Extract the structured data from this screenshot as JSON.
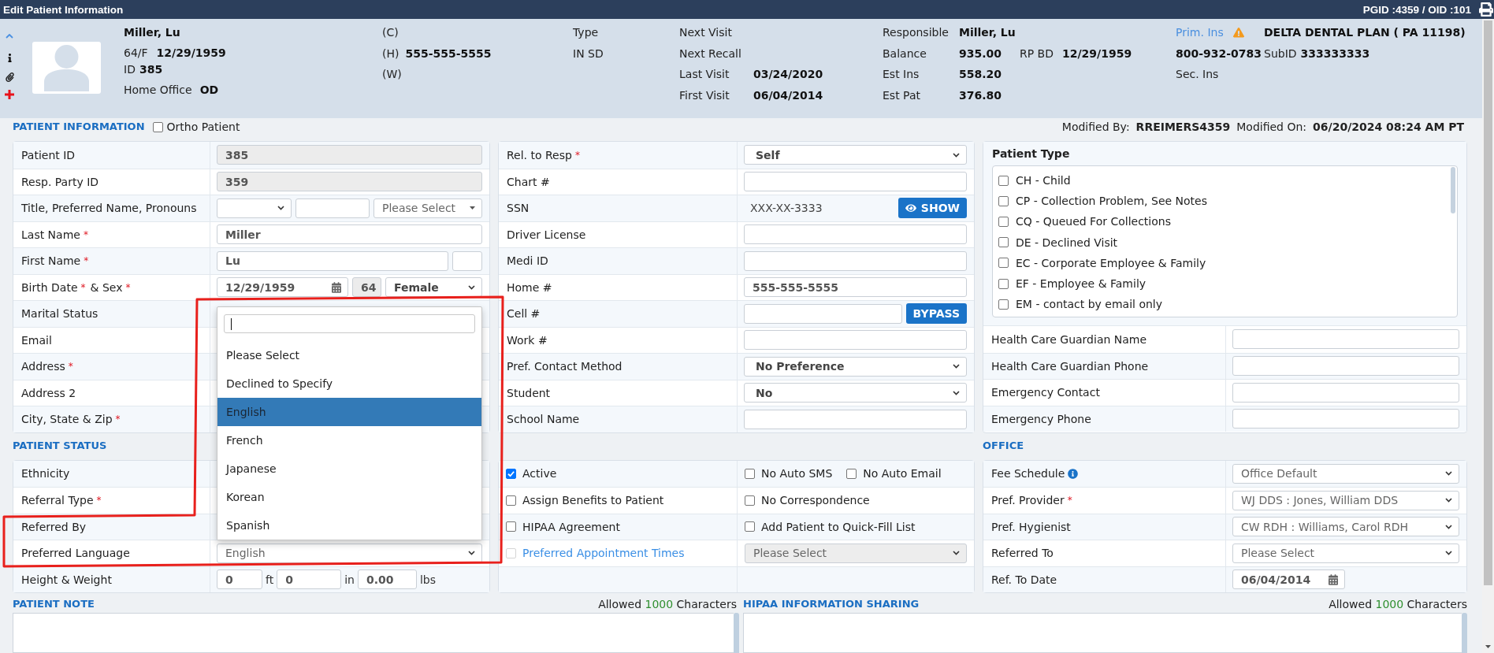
{
  "window": {
    "title": "Edit Patient Information",
    "ids": "PGID :4359 / OID :101"
  },
  "required_mark": "*",
  "header": {
    "name": "Miller, Lu",
    "age_sex": "64/F",
    "birth_date": "12/29/1959",
    "id_label": "ID",
    "id": "385",
    "office_label": "Home Office",
    "office": "OD",
    "phones": [
      {
        "label": "(C)"
      },
      {
        "label": "(H)",
        "value": "555-555-5555"
      },
      {
        "label": "(W)"
      }
    ],
    "type": {
      "label": "Type",
      "value": "IN SD"
    },
    "visits": [
      {
        "label": "Next Visit"
      },
      {
        "label": "Next Recall"
      },
      {
        "label": "Last Visit",
        "value": "03/24/2020"
      },
      {
        "label": "First Visit",
        "value": "06/04/2014"
      }
    ],
    "account": [
      {
        "label": "Responsible",
        "value": "Miller, Lu"
      },
      {
        "label": "Balance",
        "value": "935.00",
        "extra_label": "RP BD",
        "extra_value": "12/29/1959"
      },
      {
        "label": "Est Ins",
        "value": "558.20"
      },
      {
        "label": "Est Pat",
        "value": "376.80"
      }
    ],
    "insurance": {
      "primary_label": "Prim. Ins",
      "primary_warning": true,
      "primary_plan": "DELTA DENTAL PLAN ( PA 11198)",
      "primary_phone": "800-932-0783",
      "subid_label": "SubID",
      "subid": "333333333",
      "secondary_label": "Sec. Ins"
    }
  },
  "patient_information": {
    "title": "PATIENT INFORMATION",
    "ortho": {
      "label": "Ortho Patient",
      "checked": false
    },
    "modified": {
      "by_label": "Modified By:",
      "by": "RREIMERS4359",
      "on_label": "Modified On:",
      "on": "06/20/2024 08:24 AM PT"
    },
    "left_rows": [
      {
        "label": "Patient ID",
        "kind": "readonly",
        "value": "385"
      },
      {
        "label": "Resp. Party ID",
        "kind": "readonly",
        "value": "359"
      },
      {
        "label": "Title, Preferred Name, Pronouns",
        "kind": "title_name_pronouns",
        "pronouns_placeholder": "Please Select"
      },
      {
        "label": "Last Name",
        "required": true,
        "kind": "text",
        "value": "Miller"
      },
      {
        "label": "First Name",
        "required": true,
        "kind": "name_suffix",
        "value": "Lu"
      },
      {
        "label": "Birth Date",
        "required": true,
        "extra_label": "& Sex",
        "extra_required": true,
        "kind": "birth_sex",
        "birth_date": "12/29/1959",
        "age": "64",
        "sex": "Female"
      },
      {
        "label": "Marital Status",
        "kind": "covered"
      },
      {
        "label": "Email",
        "kind": "covered"
      },
      {
        "label": "Address",
        "required": true,
        "kind": "covered"
      },
      {
        "label": "Address 2",
        "kind": "covered"
      },
      {
        "label": "City, State & Zip",
        "required": true,
        "kind": "covered"
      }
    ],
    "middle_rows": [
      {
        "label": "Rel. to Resp",
        "required": true,
        "kind": "select",
        "value": "Self"
      },
      {
        "label": "Chart #",
        "kind": "text"
      },
      {
        "label": "SSN",
        "kind": "masked",
        "value": "XXX-XX-3333",
        "button": "SHOW"
      },
      {
        "label": "Driver License",
        "kind": "text"
      },
      {
        "label": "Medi ID",
        "kind": "text"
      },
      {
        "label": "Home #",
        "kind": "text",
        "value": "555-555-5555"
      },
      {
        "label": "Cell #",
        "kind": "text_button",
        "button": "BYPASS"
      },
      {
        "label": "Work #",
        "kind": "text"
      },
      {
        "label": "Pref. Contact Method",
        "kind": "select",
        "value": "No Preference"
      },
      {
        "label": "Student",
        "kind": "select",
        "value": "No"
      },
      {
        "label": "School Name",
        "kind": "text"
      }
    ],
    "patient_type": {
      "title": "Patient Type",
      "options": [
        {
          "label": "CH - Child",
          "checked": false
        },
        {
          "label": "CP - Collection Problem, See Notes",
          "checked": false
        },
        {
          "label": "CQ - Queued For Collections",
          "checked": false
        },
        {
          "label": "DE - Declined Visit",
          "checked": false
        },
        {
          "label": "EC - Corporate Employee & Family",
          "checked": false
        },
        {
          "label": "EF - Employee & Family",
          "checked": false
        },
        {
          "label": "EM - contact by email only",
          "checked": false
        }
      ]
    },
    "right_rows": [
      {
        "label": "Health Care Guardian Name",
        "kind": "text"
      },
      {
        "label": "Health Care Guardian Phone",
        "kind": "text"
      },
      {
        "label": "Emergency Contact",
        "kind": "text"
      },
      {
        "label": "Emergency Phone",
        "kind": "text"
      }
    ]
  },
  "patient_status": {
    "title": "PATIENT STATUS",
    "rows": [
      {
        "label": "Ethnicity",
        "kind": "covered"
      },
      {
        "label": "Referral Type",
        "required": true,
        "kind": "covered"
      },
      {
        "label": "Referred By",
        "kind": "covered"
      },
      {
        "label": "Preferred Language",
        "kind": "select",
        "value": "English",
        "open": true,
        "options": [
          {
            "label": "Please Select",
            "selected": false
          },
          {
            "label": "Declined to Specify",
            "selected": false
          },
          {
            "label": "English",
            "selected": true
          },
          {
            "label": "French",
            "selected": false
          },
          {
            "label": "Japanese",
            "selected": false
          },
          {
            "label": "Korean",
            "selected": false
          },
          {
            "label": "Spanish",
            "selected": false
          }
        ]
      },
      {
        "label": "Height & Weight",
        "kind": "height_weight",
        "feet": "0",
        "feet_unit": "ft",
        "inches": "0",
        "inches_unit": "in",
        "weight": "0.00",
        "weight_unit": "lbs"
      }
    ],
    "flag_rows": [
      {
        "left": [
          {
            "kind": "checkbox",
            "label": "Active",
            "checked": true,
            "disabled": false
          }
        ],
        "right": [
          {
            "kind": "checkbox",
            "label": "No Auto SMS",
            "checked": false,
            "disabled": false
          },
          {
            "kind": "checkbox",
            "label": "No Auto Email",
            "checked": false,
            "disabled": false
          }
        ]
      },
      {
        "left": [
          {
            "kind": "checkbox",
            "label": "Assign Benefits to Patient",
            "checked": false,
            "disabled": false
          }
        ],
        "right": [
          {
            "kind": "checkbox",
            "label": "No Correspondence",
            "checked": false,
            "disabled": false
          }
        ]
      },
      {
        "left": [
          {
            "kind": "checkbox",
            "label": "HIPAA Agreement",
            "checked": false,
            "disabled": false
          }
        ],
        "right": [
          {
            "kind": "checkbox",
            "label": "Add Patient to Quick-Fill List",
            "checked": false,
            "disabled": false
          }
        ]
      },
      {
        "left": [
          {
            "kind": "link_checkbox",
            "label": "Preferred Appointment Times",
            "checked": false,
            "disabled": true
          }
        ],
        "right": [
          {
            "kind": "select",
            "placeholder": "Please Select",
            "disabled": true
          }
        ]
      }
    ]
  },
  "office": {
    "title": "OFFICE",
    "rows": [
      {
        "label": "Fee Schedule",
        "info": true,
        "kind": "select",
        "value": "Office Default"
      },
      {
        "label": "Pref. Provider",
        "required": true,
        "kind": "select",
        "value": "WJ DDS : Jones, William DDS"
      },
      {
        "label": "Pref. Hygienist",
        "kind": "select",
        "value": "CW RDH : Williams, Carol RDH"
      },
      {
        "label": "Referred To",
        "kind": "select",
        "value": "Please Select"
      },
      {
        "label": "Ref. To Date",
        "kind": "date",
        "value": "06/04/2014"
      }
    ]
  },
  "notes": [
    {
      "title": "PATIENT NOTE",
      "limit_before": "Allowed",
      "limit": "1000",
      "limit_after": "Characters"
    },
    {
      "title": "HIPAA INFORMATION SHARING",
      "limit_before": "Allowed",
      "limit": "1000",
      "limit_after": "Characters"
    }
  ]
}
